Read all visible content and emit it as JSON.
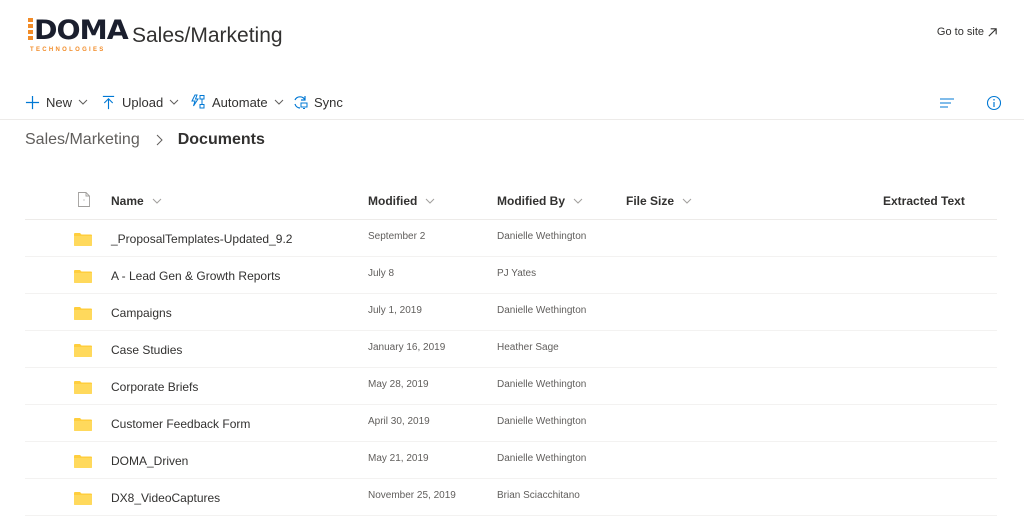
{
  "header": {
    "logo": {
      "main": "DOMA",
      "sub": "TECHNOLOGIES"
    },
    "site_title": "Sales/Marketing",
    "goto_site": "Go to site"
  },
  "commandbar": {
    "new": "New",
    "upload": "Upload",
    "automate": "Automate",
    "sync": "Sync"
  },
  "breadcrumb": {
    "root": "Sales/Marketing",
    "current": "Documents"
  },
  "table": {
    "columns": {
      "name": "Name",
      "modified": "Modified",
      "modified_by": "Modified By",
      "file_size": "File Size",
      "extracted_text": "Extracted Text"
    },
    "rows": [
      {
        "name": "_ProposalTemplates-Updated_9.2",
        "modified": "September 2",
        "modified_by": "Danielle Wethington"
      },
      {
        "name": "A - Lead Gen & Growth Reports",
        "modified": "July 8",
        "modified_by": "PJ Yates"
      },
      {
        "name": "Campaigns",
        "modified": "July 1, 2019",
        "modified_by": "Danielle Wethington"
      },
      {
        "name": "Case Studies",
        "modified": "January 16, 2019",
        "modified_by": "Heather Sage"
      },
      {
        "name": "Corporate Briefs",
        "modified": "May 28, 2019",
        "modified_by": "Danielle Wethington"
      },
      {
        "name": "Customer Feedback Form",
        "modified": "April 30, 2019",
        "modified_by": "Danielle Wethington"
      },
      {
        "name": "DOMA_Driven",
        "modified": "May 21, 2019",
        "modified_by": "Danielle Wethington"
      },
      {
        "name": "DX8_VideoCaptures",
        "modified": "November 25, 2019",
        "modified_by": "Brian Sciacchitano"
      }
    ]
  },
  "colors": {
    "accent": "#0078d4",
    "logo_orange": "#f28c28",
    "logo_dark": "#1b1f2e",
    "folder": "#ffce3d"
  }
}
